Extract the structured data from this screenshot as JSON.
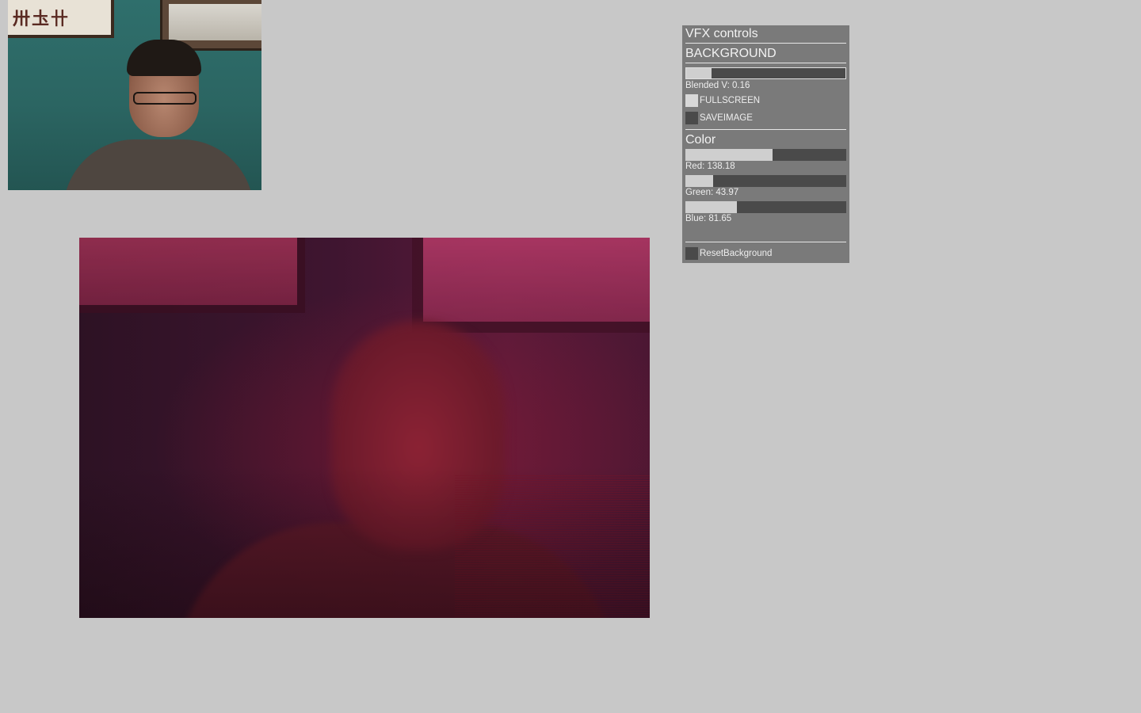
{
  "panel": {
    "title": "VFX controls",
    "background_section": {
      "title": "BACKGROUND",
      "blended": {
        "label": "Blended V: 0.16",
        "value": 0.16,
        "min": 0,
        "max": 1
      },
      "fullscreen": {
        "label": "FULLSCREEN",
        "checked": true
      },
      "saveimage": {
        "label": "SAVEIMAGE",
        "checked": false
      }
    },
    "color_section": {
      "title": "Color",
      "red": {
        "label": "Red: 138.18",
        "value": 138.18,
        "min": 0,
        "max": 255
      },
      "green": {
        "label": "Green: 43.97",
        "value": 43.97,
        "min": 0,
        "max": 255
      },
      "blue": {
        "label": "Blue: 81.65",
        "value": 81.65,
        "min": 0,
        "max": 255
      }
    },
    "reset": {
      "label": "ResetBackground",
      "checked": false
    }
  },
  "thumbnail": {
    "frame_text": "卅圡卄"
  },
  "colors": {
    "page_bg": "#c8c8c8",
    "panel_bg": "#7a7a7a",
    "slider_track": "#4a4a4a",
    "slider_fill": "#cfcfcf",
    "text": "#eeeeee"
  }
}
